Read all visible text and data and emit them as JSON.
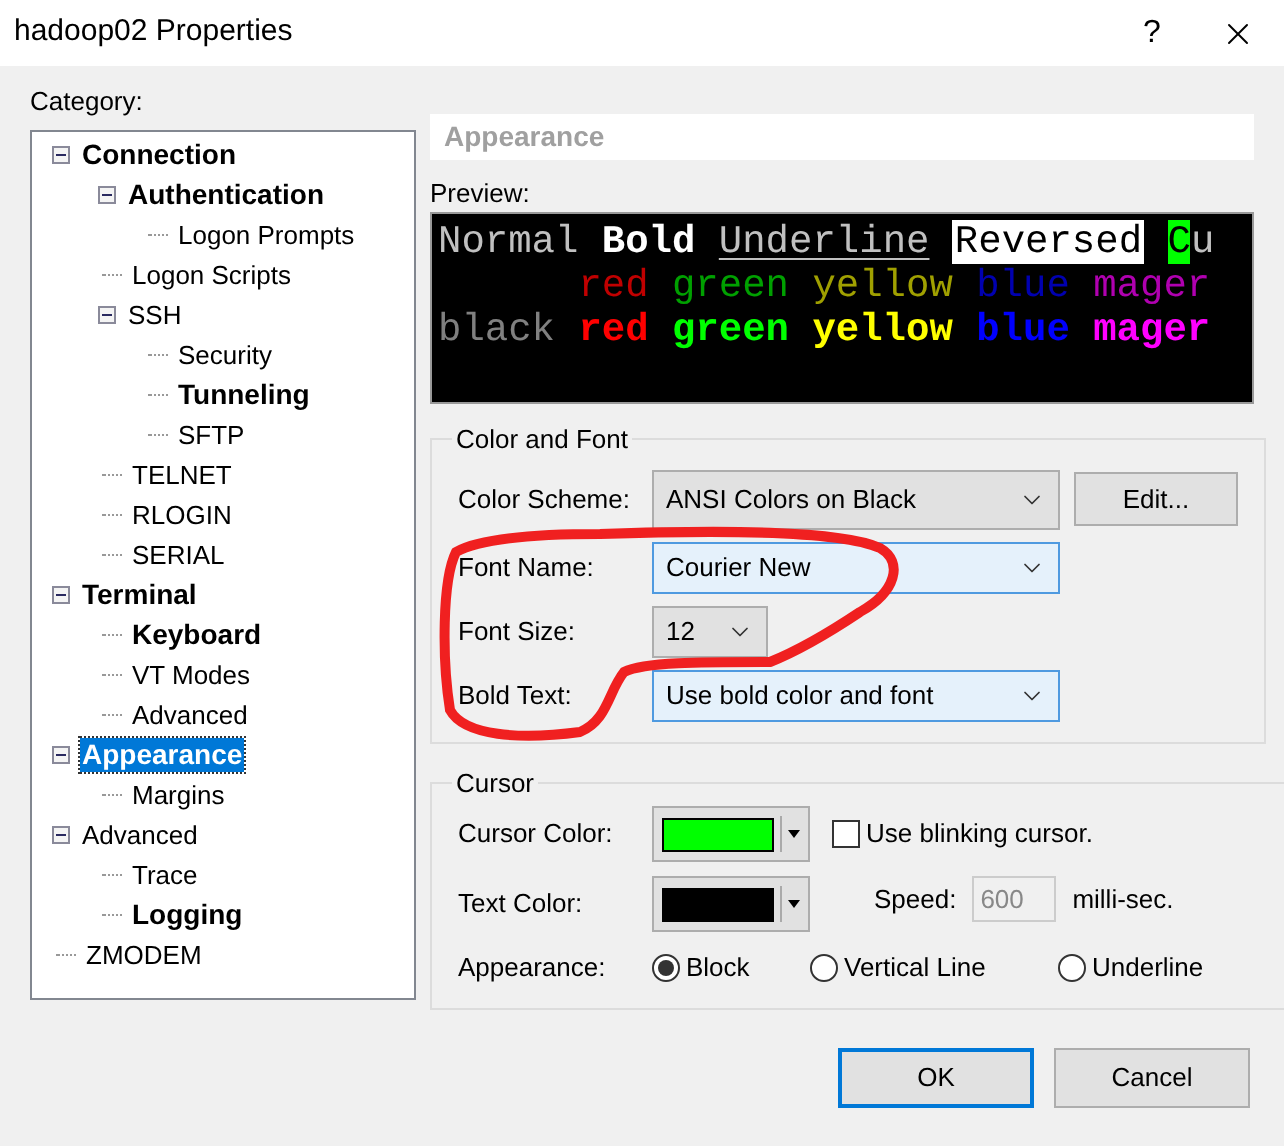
{
  "window": {
    "title": "hadoop02 Properties",
    "help": "?"
  },
  "category": {
    "label": "Category:",
    "tree": [
      {
        "label": "Connection",
        "bold": true,
        "selected": false,
        "expanded": true,
        "children": [
          {
            "label": "Authentication",
            "bold": true,
            "selected": false,
            "expanded": true,
            "children": [
              {
                "label": "Logon Prompts",
                "bold": false,
                "selected": false
              }
            ]
          },
          {
            "label": "Logon Scripts",
            "bold": false,
            "selected": false
          },
          {
            "label": "SSH",
            "bold": false,
            "selected": false,
            "expanded": true,
            "children": [
              {
                "label": "Security",
                "bold": false,
                "selected": false
              },
              {
                "label": "Tunneling",
                "bold": true,
                "selected": false
              },
              {
                "label": "SFTP",
                "bold": false,
                "selected": false
              }
            ]
          },
          {
            "label": "TELNET",
            "bold": false,
            "selected": false
          },
          {
            "label": "RLOGIN",
            "bold": false,
            "selected": false
          },
          {
            "label": "SERIAL",
            "bold": false,
            "selected": false
          }
        ]
      },
      {
        "label": "Terminal",
        "bold": true,
        "selected": false,
        "expanded": true,
        "children": [
          {
            "label": "Keyboard",
            "bold": true,
            "selected": false
          },
          {
            "label": "VT Modes",
            "bold": false,
            "selected": false
          },
          {
            "label": "Advanced",
            "bold": false,
            "selected": false
          }
        ]
      },
      {
        "label": "Appearance",
        "bold": true,
        "selected": true,
        "expanded": true,
        "children": [
          {
            "label": "Margins",
            "bold": false,
            "selected": false
          }
        ]
      },
      {
        "label": "Advanced",
        "bold": false,
        "selected": false,
        "expanded": true,
        "children": [
          {
            "label": "Trace",
            "bold": false,
            "selected": false
          },
          {
            "label": "Logging",
            "bold": true,
            "selected": false
          }
        ]
      },
      {
        "label": "ZMODEM",
        "bold": false,
        "selected": false
      }
    ]
  },
  "panel": {
    "header": "Appearance",
    "preview_label": "Preview:",
    "preview_lines": [
      [
        {
          "text": "Normal",
          "kind": "normal"
        },
        {
          "text": "Bold",
          "kind": "bold"
        },
        {
          "text": "Underline",
          "kind": "underline"
        },
        {
          "text": "Reversed",
          "kind": "reversed"
        },
        {
          "text": "C",
          "kind": "cursor"
        },
        {
          "text": "u",
          "kind": "normal"
        }
      ],
      [
        {
          "text": "red",
          "kind": "color",
          "color": "#c00000"
        },
        {
          "text": "green",
          "kind": "color",
          "color": "#00a000"
        },
        {
          "text": "yellow",
          "kind": "color",
          "color": "#a0a000"
        },
        {
          "text": "blue",
          "kind": "color",
          "color": "#0000b0"
        },
        {
          "text": "mager",
          "kind": "color",
          "color": "#b000b0"
        }
      ],
      [
        {
          "text": "black",
          "kind": "color",
          "color": "#808080"
        },
        {
          "text": "red",
          "kind": "bright",
          "color": "#ff0000"
        },
        {
          "text": "green",
          "kind": "bright",
          "color": "#00ff00"
        },
        {
          "text": "yellow",
          "kind": "bright",
          "color": "#ffff00"
        },
        {
          "text": "blue",
          "kind": "bright",
          "color": "#0000ff"
        },
        {
          "text": "mager",
          "kind": "bright",
          "color": "#ff00ff"
        }
      ]
    ],
    "color_and_font": {
      "title": "Color and Font",
      "color_scheme": {
        "label": "Color Scheme:",
        "value": "ANSI Colors on Black",
        "button": "Edit...",
        "highlighted": false
      },
      "font_name": {
        "label": "Font Name:",
        "value": "Courier New",
        "highlighted": true
      },
      "font_size": {
        "label": "Font Size:",
        "value": "12",
        "highlighted": false
      },
      "bold_text": {
        "label": "Bold Text:",
        "value": "Use bold color and font",
        "highlighted": true
      }
    },
    "cursor": {
      "title": "Cursor",
      "cursor_color": {
        "label": "Cursor Color:",
        "color": "#00ff00"
      },
      "blinking": {
        "label": "Use blinking cursor.",
        "checked": false
      },
      "text_color": {
        "label": "Text Color:",
        "color": "#000000"
      },
      "speed": {
        "label": "Speed:",
        "value": "600",
        "unit": "milli-sec.",
        "disabled": true
      },
      "appearance": {
        "label": "Appearance:",
        "options": [
          {
            "label": "Block",
            "selected": true
          },
          {
            "label": "Vertical Line",
            "selected": false
          },
          {
            "label": "Underline",
            "selected": false
          }
        ]
      }
    }
  },
  "annotation": {
    "kind": "ellipse"
  },
  "buttons": [
    {
      "label": "OK",
      "default": true
    },
    {
      "label": "Cancel",
      "default": false
    }
  ]
}
